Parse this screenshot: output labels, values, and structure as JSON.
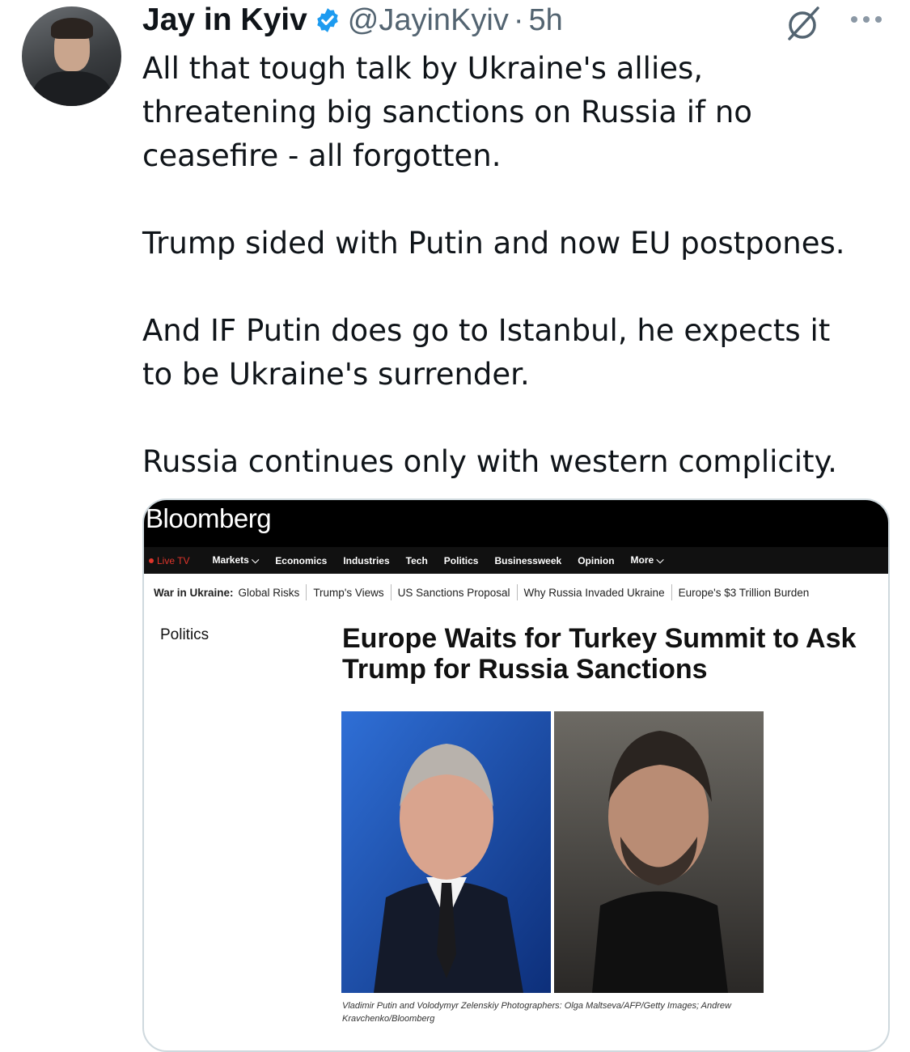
{
  "tweet": {
    "author_name": "Jay in Kyiv",
    "author_handle": "@JayinKyiv",
    "separator": "·",
    "timestamp": "5h",
    "verified": true,
    "accent_color": "#1d9bf0",
    "text_lines": [
      "All that tough talk by Ukraine's allies,",
      "threatening big sanctions on Russia if no",
      "ceasefire - all forgotten.",
      "",
      "Trump sided with Putin and now EU postpones.",
      "",
      "And IF Putin does go to Istanbul, he expects it",
      "to be Ukraine's surrender.",
      "",
      "Russia continues only with western complicity."
    ],
    "icons": {
      "avatar": "avatar",
      "verified": "verified-badge-icon",
      "grok": "grok-icon",
      "more": "more-options-icon"
    }
  },
  "card": {
    "logo": "Bloomberg",
    "nav": {
      "live": "Live TV",
      "items": [
        "Markets",
        "Economics",
        "Industries",
        "Tech",
        "Politics",
        "Businessweek",
        "Opinion",
        "More"
      ]
    },
    "subnav": {
      "lead": "War in Ukraine:",
      "items": [
        "Global Risks",
        "Trump's Views",
        "US Sanctions Proposal",
        "Why Russia Invaded Ukraine",
        "Europe's $3 Trillion Burden"
      ]
    },
    "section": "Politics",
    "headline": "Europe Waits for Turkey Summit to Ask Trump for Russia Sanctions",
    "caption_names": "Vladimir Putin and Volodymyr Zelenskiy",
    "caption_credit": "Photographers: Olga Maltseva/AFP/Getty Images; Andrew Kravchenko/Bloomberg"
  }
}
